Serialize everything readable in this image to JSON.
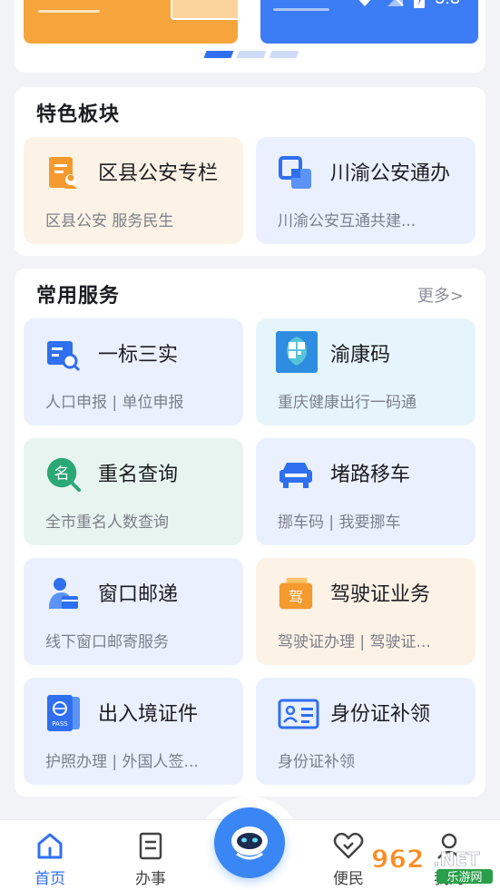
{
  "status": {
    "time": "5:3"
  },
  "carousel": {
    "dots": 3,
    "active_index": 0
  },
  "featured": {
    "title": "特色板块",
    "tiles": [
      {
        "name": "区县公安专栏",
        "desc": "区县公安 服务民生",
        "icon": "document-user-icon"
      },
      {
        "name": "川渝公安通办",
        "desc": "川渝公安互通共建...",
        "icon": "squares-link-icon"
      }
    ]
  },
  "services": {
    "title": "常用服务",
    "more": "更多>",
    "tiles": [
      {
        "name": "一标三实",
        "desc": "人口申报 | 单位申报",
        "icon": "search-form-icon"
      },
      {
        "name": "渝康码",
        "desc": "重庆健康出行一码通",
        "icon": "health-code-icon",
        "icon_text": "健康码"
      },
      {
        "name": "重名查询",
        "desc": "全市重名人数查询",
        "icon": "name-search-icon",
        "icon_text": "名"
      },
      {
        "name": "堵路移车",
        "desc": "挪车码 | 我要挪车",
        "icon": "car-icon"
      },
      {
        "name": "窗口邮递",
        "desc": "线下窗口邮寄服务",
        "icon": "courier-icon"
      },
      {
        "name": "驾驶证业务",
        "desc": "驾驶证办理 | 驾驶证...",
        "icon": "driver-license-icon",
        "icon_text": "驾"
      },
      {
        "name": "出入境证件",
        "desc": "护照办理 | 外国人签...",
        "icon": "passport-icon",
        "icon_text": "PASS"
      },
      {
        "name": "身份证补领",
        "desc": "身份证补领",
        "icon": "id-card-icon"
      }
    ]
  },
  "nav": {
    "items": [
      {
        "label": "首页",
        "icon": "home-icon",
        "active": true
      },
      {
        "label": "办事",
        "icon": "document-icon",
        "active": false
      },
      {
        "label": "便民",
        "icon": "heart-icon",
        "active": false
      },
      {
        "label": "我的",
        "icon": "user-icon",
        "active": false
      }
    ],
    "center_icon": "robot-assistant-icon"
  },
  "watermark": {
    "logo": "962",
    "suffix": ".NET",
    "site": "乐游网"
  },
  "colors": {
    "accent": "#3a86f5",
    "orange": "#f5a53c",
    "blue_banner": "#3c7cf5"
  }
}
